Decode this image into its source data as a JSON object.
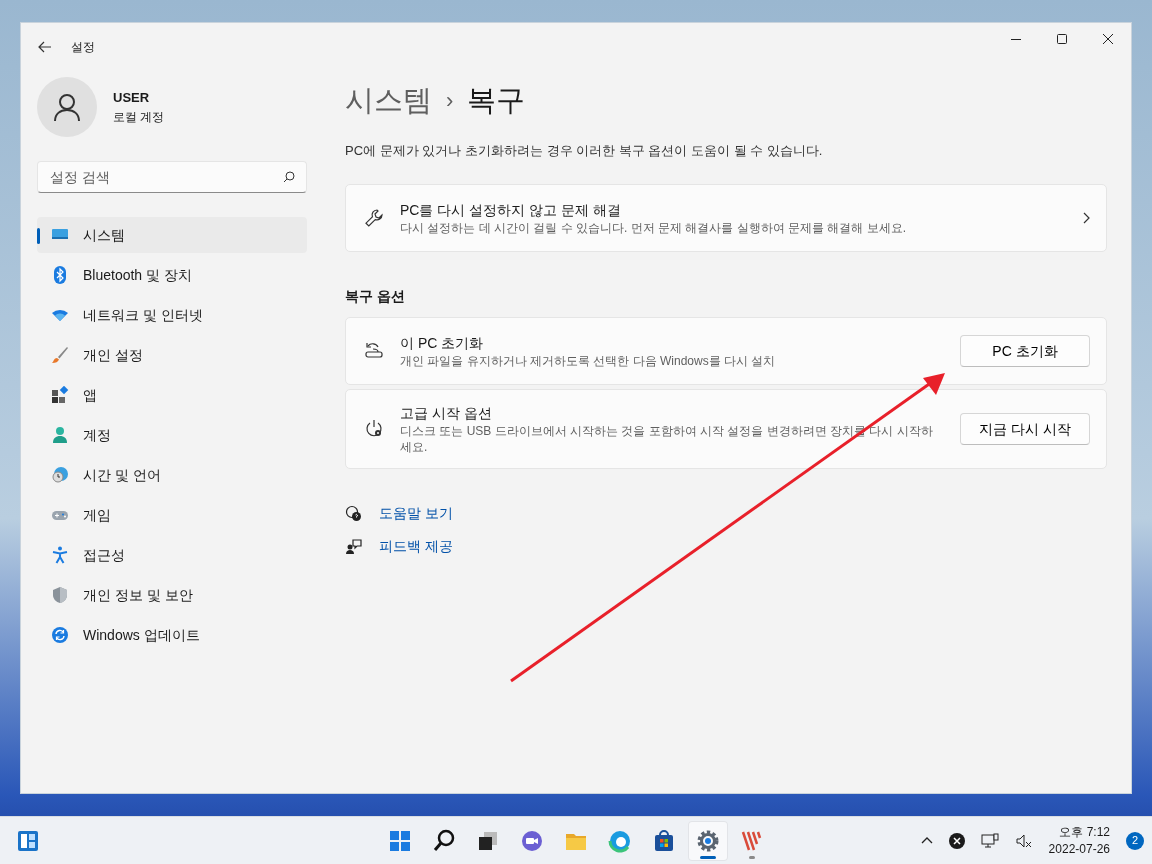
{
  "window": {
    "title": "설정"
  },
  "account": {
    "name": "USER",
    "type": "로컬 계정"
  },
  "search": {
    "placeholder": "설정 검색"
  },
  "sidebar": {
    "items": [
      {
        "label": "시스템",
        "selected": true
      },
      {
        "label": "Bluetooth 및 장치",
        "selected": false
      },
      {
        "label": "네트워크 및 인터넷",
        "selected": false
      },
      {
        "label": "개인 설정",
        "selected": false
      },
      {
        "label": "앱",
        "selected": false
      },
      {
        "label": "계정",
        "selected": false
      },
      {
        "label": "시간 및 언어",
        "selected": false
      },
      {
        "label": "게임",
        "selected": false
      },
      {
        "label": "접근성",
        "selected": false
      },
      {
        "label": "개인 정보 및 보안",
        "selected": false
      },
      {
        "label": "Windows 업데이트",
        "selected": false
      }
    ]
  },
  "breadcrumb": {
    "parent": "시스템",
    "separator": "›",
    "current": "복구"
  },
  "description": "PC에 문제가 있거나 초기화하려는 경우 이러한 복구 옵션이 도움이 될 수 있습니다.",
  "troubleshoot": {
    "title": "PC를 다시 설정하지 않고 문제 해결",
    "description": "다시 설정하는 데 시간이 걸릴 수 있습니다. 먼저 문제 해결사를 실행하여 문제를 해결해 보세요."
  },
  "section_title": "복구 옵션",
  "options": [
    {
      "title": "이 PC 초기화",
      "description": "개인 파일을 유지하거나 제거하도록 선택한 다음 Windows를 다시 설치",
      "button": "PC 초기화"
    },
    {
      "title": "고급 시작 옵션",
      "description": "디스크 또는 USB 드라이브에서 시작하는 것을 포함하여 시작 설정을 변경하려면 장치를 다시 시작하세요.",
      "button": "지금 다시 시작"
    }
  ],
  "links": [
    "도움말 보기",
    "피드백 제공"
  ],
  "taskbar": {
    "apps": [
      {
        "active": false,
        "running": false
      },
      {
        "active": false,
        "running": false
      },
      {
        "active": false,
        "running": false
      },
      {
        "active": false,
        "running": false
      },
      {
        "active": false,
        "running": false
      },
      {
        "active": false,
        "running": false
      },
      {
        "active": false,
        "running": false
      },
      {
        "active": true,
        "running": true
      },
      {
        "active": false,
        "running": true
      }
    ],
    "time": "오후 7:12",
    "date": "2022-07-26",
    "notifications": "2"
  }
}
